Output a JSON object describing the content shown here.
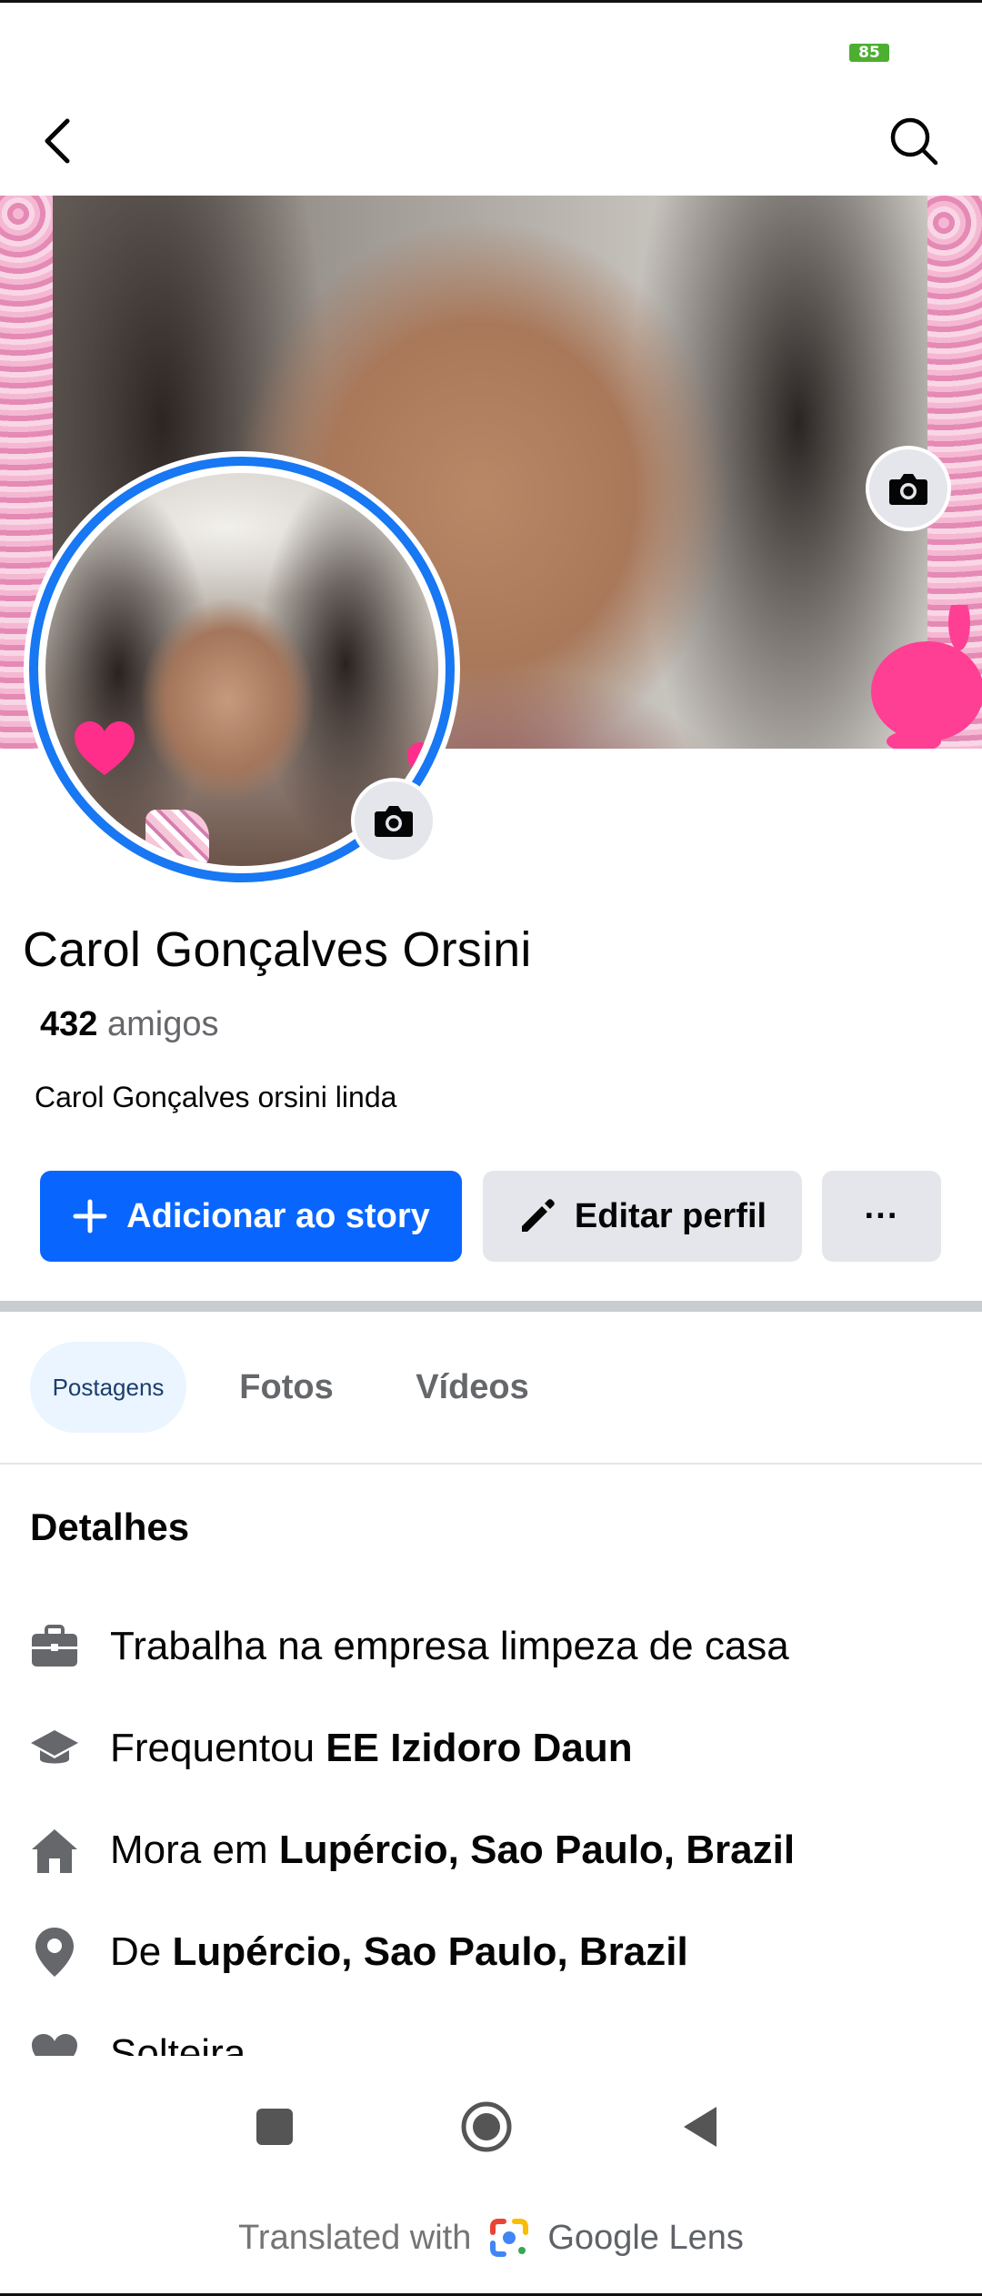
{
  "status_bar": {
    "battery": "85"
  },
  "profile": {
    "name": "Carol Gonçalves Orsini",
    "friends_count": "432",
    "friends_label": "amigos",
    "bio": "Carol Gonçalves orsini linda"
  },
  "actions": {
    "add_story": "Adicionar ao story",
    "edit_profile": "Editar perfil",
    "more": "···"
  },
  "tabs": [
    {
      "label": "Postagens",
      "active": true
    },
    {
      "label": "Fotos",
      "active": false
    },
    {
      "label": "Vídeos",
      "active": false
    }
  ],
  "details": {
    "title": "Detalhes",
    "items": [
      {
        "icon": "briefcase-icon",
        "prefix": "Trabalha na empresa limpeza de casa",
        "bold": ""
      },
      {
        "icon": "graduation-cap-icon",
        "prefix": "Frequentou ",
        "bold": "EE Izidoro Daun"
      },
      {
        "icon": "house-icon",
        "prefix": "Mora em ",
        "bold": "Lupércio, Sao Paulo, Brazil"
      },
      {
        "icon": "location-pin-icon",
        "prefix": "De ",
        "bold": "Lupércio, Sao Paulo, Brazil"
      },
      {
        "icon": "heart-icon",
        "prefix": "Solteira",
        "bold": ""
      }
    ]
  },
  "footer": {
    "translated_with": "Translated with",
    "brand": "Google Lens"
  },
  "colors": {
    "primary_blue": "#0866ff",
    "avatar_ring": "#1877f2",
    "secondary_button": "#e4e6eb",
    "muted_text": "#65676b"
  }
}
